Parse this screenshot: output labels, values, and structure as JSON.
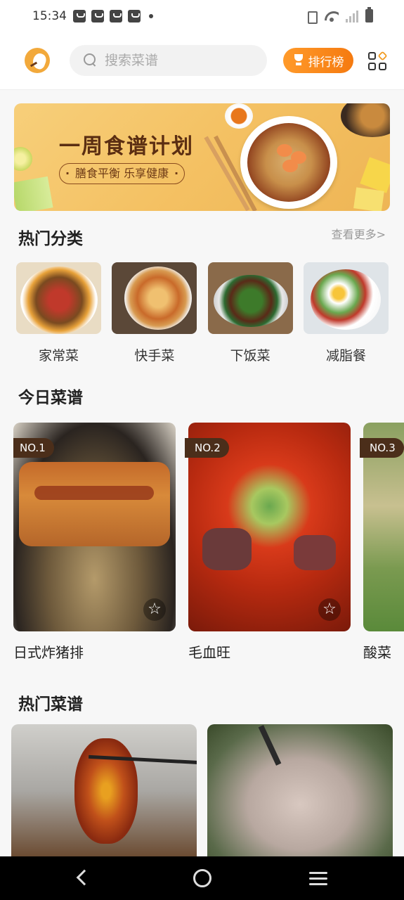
{
  "status_bar": {
    "time": "15:34",
    "icons": [
      "notification-icon",
      "notification-icon",
      "notification-icon",
      "notification-icon",
      "more-dot",
      "vibrate-icon",
      "wifi-icon",
      "signal-icon",
      "battery-icon"
    ]
  },
  "header": {
    "search_placeholder": "搜索菜谱",
    "rank_button": "排行榜",
    "accent_color": "#f57a10"
  },
  "banner": {
    "title": "一周食谱计划",
    "subtitle": "膳食平衡 乐享健康"
  },
  "categories": {
    "title": "热门分类",
    "more": "查看更多>",
    "items": [
      {
        "label": "家常菜"
      },
      {
        "label": "快手菜"
      },
      {
        "label": "下饭菜"
      },
      {
        "label": "减脂餐"
      }
    ]
  },
  "today": {
    "title": "今日菜谱",
    "items": [
      {
        "rank": "NO.1",
        "name": "日式炸猪排"
      },
      {
        "rank": "NO.2",
        "name": "毛血旺"
      },
      {
        "rank": "NO.3",
        "name": "酸菜"
      }
    ]
  },
  "hot": {
    "title": "热门菜谱"
  }
}
